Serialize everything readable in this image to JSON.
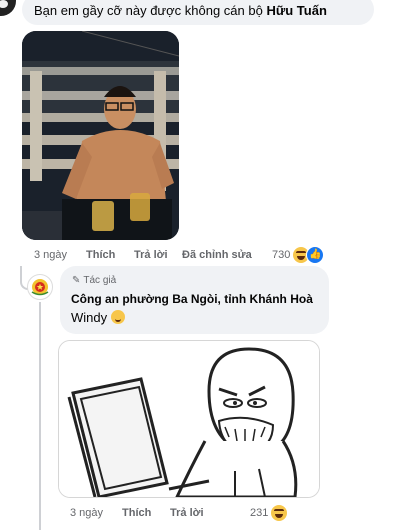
{
  "comment": {
    "text": "Bạn em gầy cỡ này được không cán bộ ",
    "mention": "Hữu Tuấn",
    "time": "3 ngày",
    "like_label": "Thích",
    "reply_label": "Trả lời",
    "edited_label": "Đã chỉnh sửa",
    "reaction_count": "730",
    "reaction_icons": [
      "haha-emoji-icon",
      "like-emoji-icon"
    ]
  },
  "reply": {
    "author_badge": "Tác giả",
    "author_name": "Công an phường Ba Ngòi, tỉnh Khánh Hoà",
    "message": "Windy",
    "time": "3 ngày",
    "like_label": "Thích",
    "reply_label": "Trả lời",
    "reaction_count": "231",
    "reaction_icons": [
      "haha-emoji-icon"
    ]
  },
  "colors": {
    "bubble": "#f0f2f5",
    "meta_text": "#65676b",
    "like_blue": "#1877f2",
    "haha_yellow": "#f7c64a"
  }
}
